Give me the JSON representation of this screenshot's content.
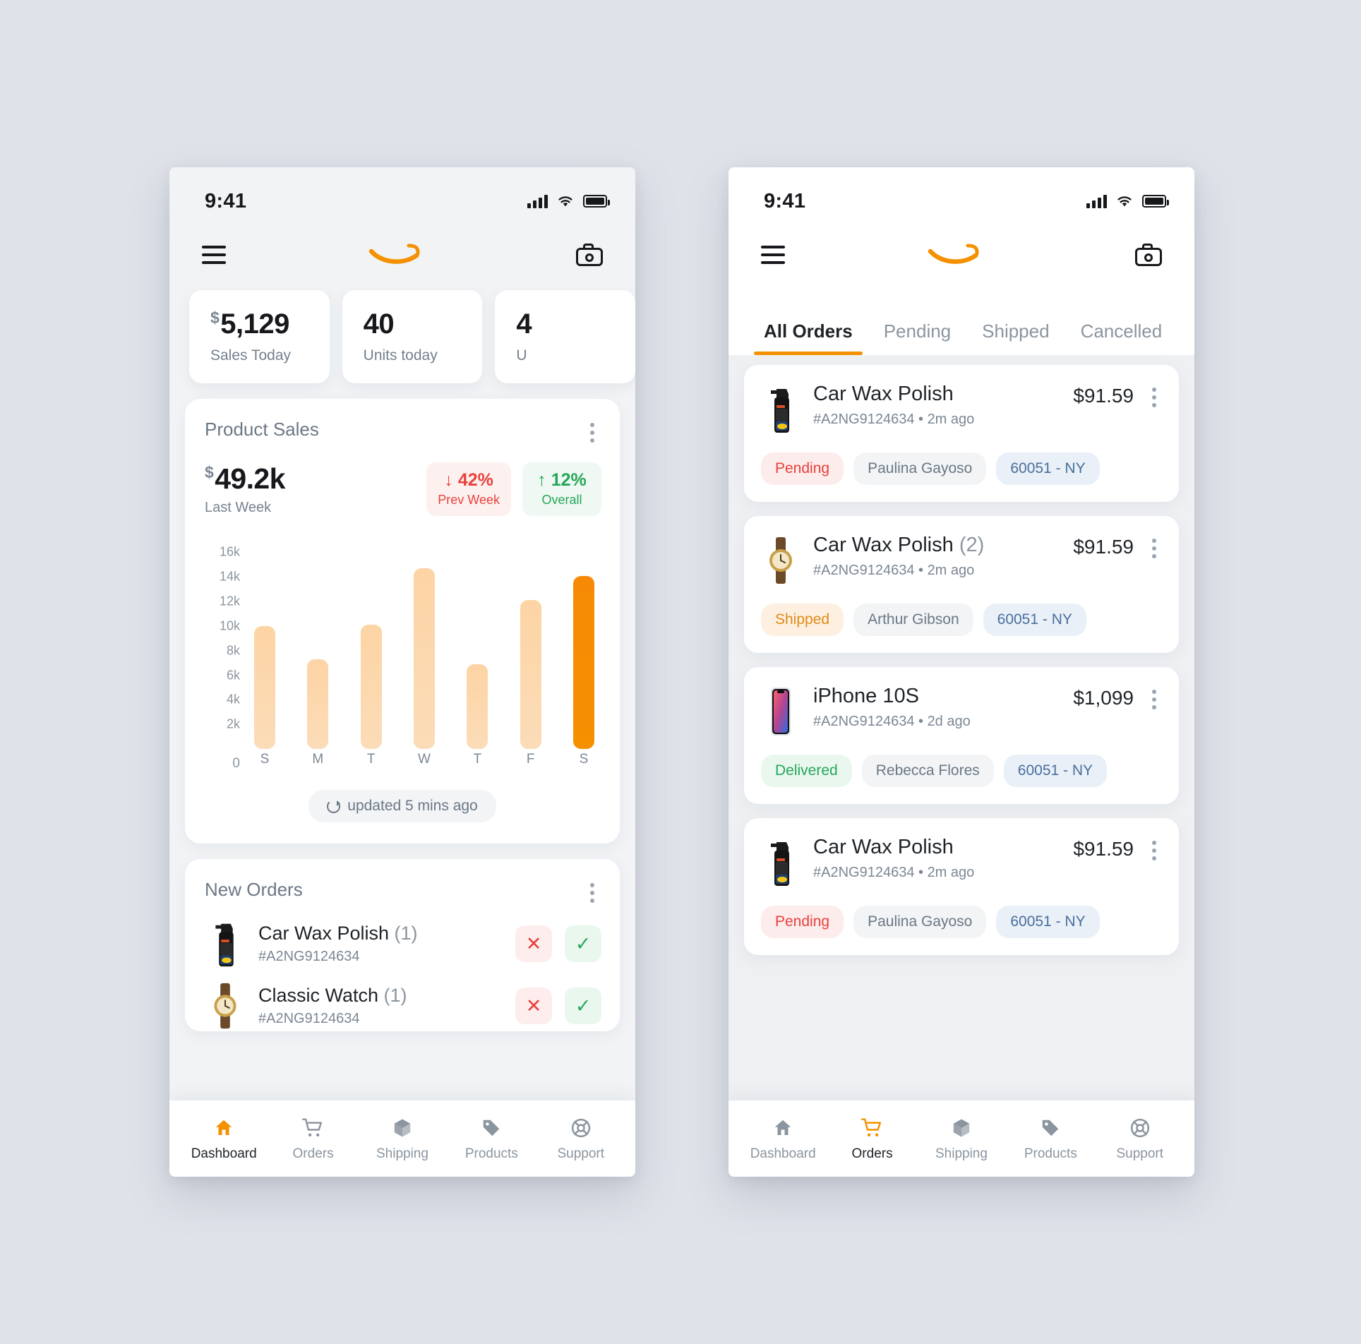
{
  "status_bar": {
    "time": "9:41"
  },
  "brand": {
    "accent": "#f59000",
    "logo_name": "amazon-smile-logo"
  },
  "left_screen": {
    "appbar": {
      "menu": "menu-icon",
      "camera": "camera-icon"
    },
    "stats": [
      {
        "value": "5,129",
        "currency": "$",
        "label": "Sales Today"
      },
      {
        "value": "40",
        "currency": "",
        "label": "Units today"
      },
      {
        "value": "4",
        "currency": "",
        "label": "U"
      }
    ],
    "product_sales": {
      "title": "Product Sales",
      "amount": "49.2k",
      "currency": "$",
      "period": "Last Week",
      "badges": [
        {
          "arrow": "↓",
          "pct": "42%",
          "caption": "Prev Week",
          "tone": "down"
        },
        {
          "arrow": "↑",
          "pct": "12%",
          "caption": "Overall",
          "tone": "up"
        }
      ],
      "updated": "updated 5 mins ago"
    },
    "new_orders": {
      "title": "New Orders",
      "items": [
        {
          "name": "Car Wax Polish",
          "qty": "(1)",
          "id": "#A2NG9124634",
          "image": "spray"
        },
        {
          "name": "Classic Watch",
          "qty": "(1)",
          "id": "#A2NG9124634",
          "image": "watch"
        }
      ],
      "reject_label": "✕",
      "accept_label": "✓"
    },
    "tabbar": {
      "items": [
        {
          "label": "Dashboard",
          "icon": "home-icon",
          "active": true
        },
        {
          "label": "Orders",
          "icon": "cart-icon",
          "active": false
        },
        {
          "label": "Shipping",
          "icon": "box-icon",
          "active": false
        },
        {
          "label": "Products",
          "icon": "tag-icon",
          "active": false
        },
        {
          "label": "Support",
          "icon": "lifebuoy-icon",
          "active": false
        }
      ]
    }
  },
  "right_screen": {
    "tabs": [
      {
        "label": "All Orders",
        "active": true
      },
      {
        "label": "Pending",
        "active": false
      },
      {
        "label": "Shipped",
        "active": false
      },
      {
        "label": "Cancelled",
        "active": false
      }
    ],
    "orders": [
      {
        "name": "Car Wax Polish",
        "qty": "",
        "price": "$91.59",
        "id": "#A2NG9124634",
        "dot": "•",
        "time": "2m ago",
        "status": "Pending",
        "status_tone": "pending",
        "person": "Paulina Gayoso",
        "zip": "60051 - NY",
        "image": "spray"
      },
      {
        "name": "Car Wax Polish",
        "qty": "(2)",
        "price": "$91.59",
        "id": "#A2NG9124634",
        "dot": "•",
        "time": "2m ago",
        "status": "Shipped",
        "status_tone": "shipped",
        "person": "Arthur Gibson",
        "zip": "60051 - NY",
        "image": "watch"
      },
      {
        "name": "iPhone 10S",
        "qty": "",
        "price": "$1,099",
        "id": "#A2NG9124634",
        "dot": "•",
        "time": "2d ago",
        "status": "Delivered",
        "status_tone": "delivered",
        "person": "Rebecca Flores",
        "zip": "60051 - NY",
        "image": "phone"
      },
      {
        "name": "Car Wax Polish",
        "qty": "",
        "price": "$91.59",
        "id": "#A2NG9124634",
        "dot": "•",
        "time": "2m ago",
        "status": "Pending",
        "status_tone": "pending",
        "person": "Paulina Gayoso",
        "zip": "60051 - NY",
        "image": "spray"
      }
    ],
    "tabbar": {
      "items": [
        {
          "label": "Dashboard",
          "icon": "home-icon",
          "active": false
        },
        {
          "label": "Orders",
          "icon": "cart-icon",
          "active": true
        },
        {
          "label": "Shipping",
          "icon": "box-icon",
          "active": false
        },
        {
          "label": "Products",
          "icon": "tag-icon",
          "active": false
        },
        {
          "label": "Support",
          "icon": "lifebuoy-icon",
          "active": false
        }
      ]
    }
  },
  "chart_data": {
    "type": "bar",
    "title": "Product Sales",
    "categories": [
      "S",
      "M",
      "T",
      "W",
      "T",
      "F",
      "S"
    ],
    "values": [
      10000,
      7300,
      10100,
      14700,
      6900,
      12100,
      14100
    ],
    "highlight_index": 6,
    "ytick_labels": [
      "16k",
      "14k",
      "12k",
      "10k",
      "8k",
      "6k",
      "4k",
      "2k"
    ],
    "ytick_values": [
      16000,
      14000,
      12000,
      10000,
      8000,
      6000,
      4000,
      2000
    ],
    "zero_label": "0",
    "ylim": [
      0,
      17000
    ],
    "xlabel": "",
    "ylabel": "",
    "grid": false,
    "legend": "none",
    "bar_color": "#fbd4a6",
    "highlight_color": "#f68a06"
  }
}
